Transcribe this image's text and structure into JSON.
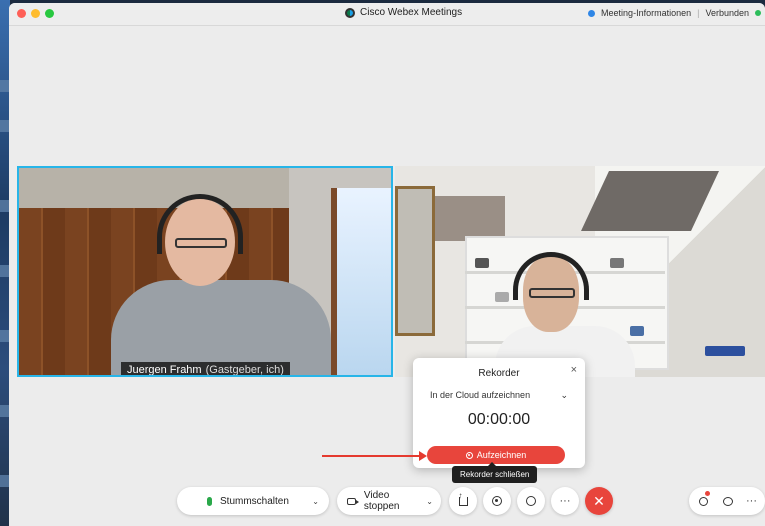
{
  "window": {
    "title": "Cisco Webex Meetings",
    "meeting_info": "Meeting-Informationen",
    "separator": "|",
    "connection_status": "Verbunden"
  },
  "videos": {
    "host": {
      "name": "Juergen Frahm",
      "role": "(Gastgeber, ich)"
    }
  },
  "recorder": {
    "title": "Rekorder",
    "close_glyph": "×",
    "mode": "In der Cloud aufzeichnen",
    "mode_chevron": "⌄",
    "time": "00:00:00",
    "record_label": "Aufzeichnen",
    "tooltip": "Rekorder schließen"
  },
  "toolbar": {
    "mute_label": "Stummschalten",
    "video_label": "Video stoppen",
    "chevron": "⌄",
    "more_glyph": "···",
    "end_glyph": "✕"
  },
  "colors": {
    "accent": "#27b5e8",
    "record": "#e8453c",
    "mic": "#2aa84a"
  }
}
